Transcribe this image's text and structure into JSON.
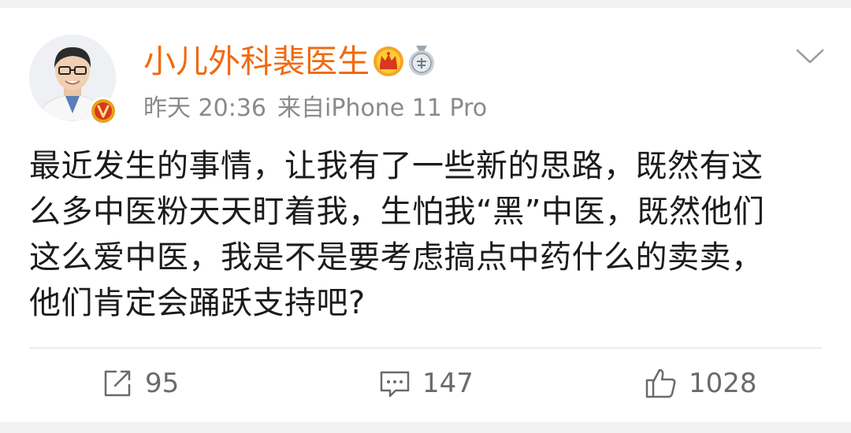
{
  "post": {
    "author": "小儿外科裴医生",
    "time": "昨天 20:36",
    "source": "来自iPhone 11 Pro",
    "text_lines": [
      "最近发生的事情，让我有了一些新的思路，既然有这",
      "么多中医粉天天盯着我，生怕我“黑”中医，既然他们",
      "这么爱中医，我是不是要考虑搞点中药什么的卖卖，",
      "他们肯定会踊跃支持吧?"
    ]
  },
  "actions": {
    "repost_count": "95",
    "comment_count": "147",
    "like_count": "1028"
  },
  "colors": {
    "author": "#f06a0f",
    "meta": "#8a8a8a",
    "text": "#1b1b1b",
    "action": "#6a6a6a",
    "verified_badge": "#e8a21a"
  },
  "icons": [
    "avatar",
    "verified-v-badge-icon",
    "crown-icon",
    "medal-icon",
    "chevron-down-icon",
    "repost-icon",
    "comment-icon",
    "like-icon"
  ]
}
